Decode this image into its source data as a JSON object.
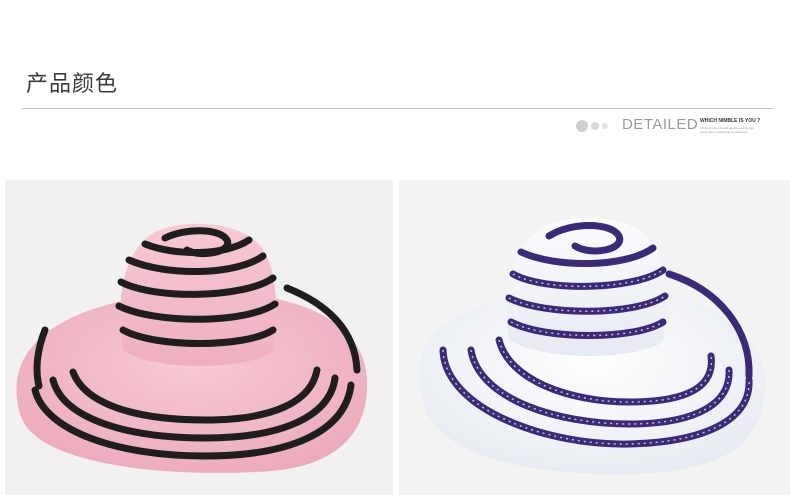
{
  "section": {
    "title": "产品颜色"
  },
  "detail_badge": {
    "word": "DETAILED",
    "tagline": "WHICH NIMBLE IS YOU ?",
    "fine_line_1": "Arbitrary sole life and quality leading text",
    "fine_line_2": "Good store small reasons seasonal"
  },
  "products": [
    {
      "color_name": "pink",
      "accent": "#f2b8c6",
      "stripe": "#1e1e1e"
    },
    {
      "color_name": "white",
      "accent": "#eef0f4",
      "stripe": "#3b2a78"
    }
  ]
}
